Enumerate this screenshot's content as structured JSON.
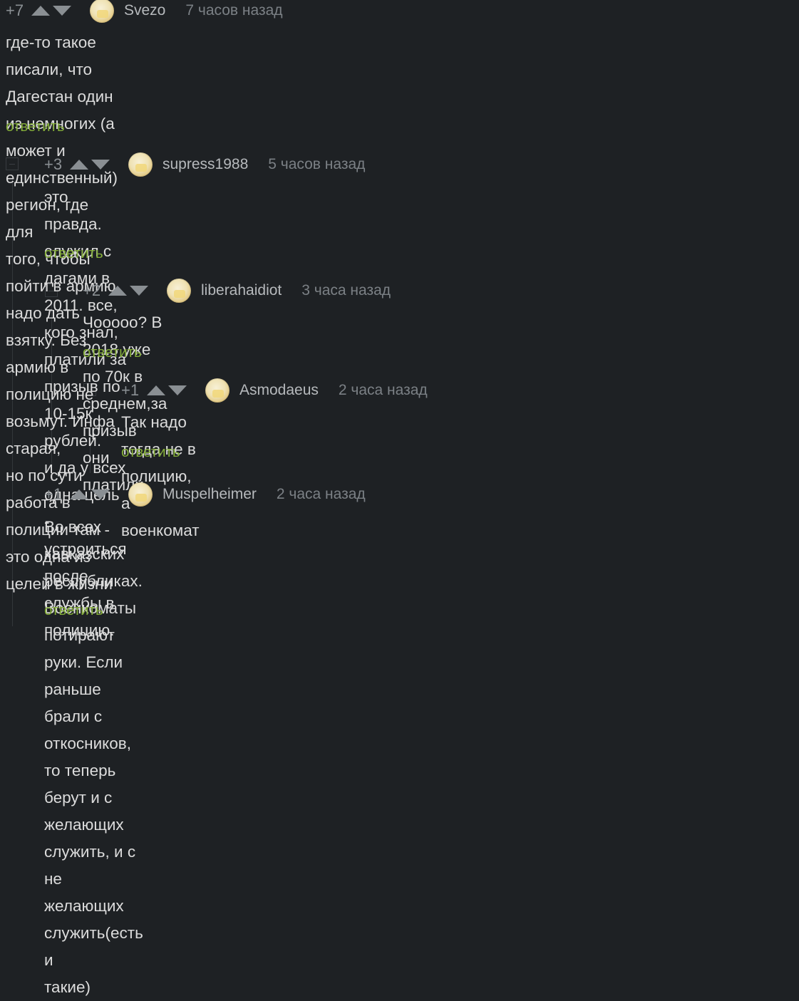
{
  "comments": [
    {
      "rating": "+7",
      "username": "Svezo",
      "time": "7 часов назад",
      "lines": [
        "где-то такое писали, что Дагестан один из немногих (а может и единственный) регион, где для",
        "того, чтобы пойти в армию надо дать взятку. Без армию в полицию не возьмут. Инфа старая,",
        "но по сути работа в полиции там - это одна из целей в жизни"
      ],
      "reply": "ответить"
    },
    {
      "rating": "+3",
      "username": "supress1988",
      "time": "5 часов назад",
      "lines": [
        "это правда. служил с дагами в 2011. все, кого знал, платили за призыв по 10-15к рублей.",
        "и да у всех одна цель - устроиться после службы в полицию."
      ],
      "reply": "ответить"
    },
    {
      "rating": "+2",
      "username": "liberahaidiot",
      "time": "3 часа назад",
      "lines": [
        "Чооооо? В 2018 уже по 70к в среднем,за призыв они платили."
      ],
      "reply": "ответить"
    },
    {
      "rating": "+1",
      "username": "Asmodaeus",
      "time": "2 часа назад",
      "lines": [
        "Так надо тогда не в полицию, а военкомат"
      ],
      "reply": "ответить"
    },
    {
      "rating": "+1",
      "username": "Muspelheimer",
      "time": "2 часа назад",
      "lines": [
        "Во всех кавказских республиках. Военкоматы потирают руки. Если раньше брали с",
        "откосников, то теперь берут и с желающих служить, и с не желающих служить(есть и",
        "такие)"
      ],
      "reply": "ответить"
    }
  ],
  "colors": {
    "background": "#1e2124",
    "reply_link": "#84ad39",
    "text": "#dcdcdc",
    "meta": "#7b8085"
  },
  "icons": {
    "upvote": "triangle-up-icon",
    "downvote": "triangle-down-icon",
    "collapse": "minus-square-icon",
    "avatar": "user-avatar"
  }
}
